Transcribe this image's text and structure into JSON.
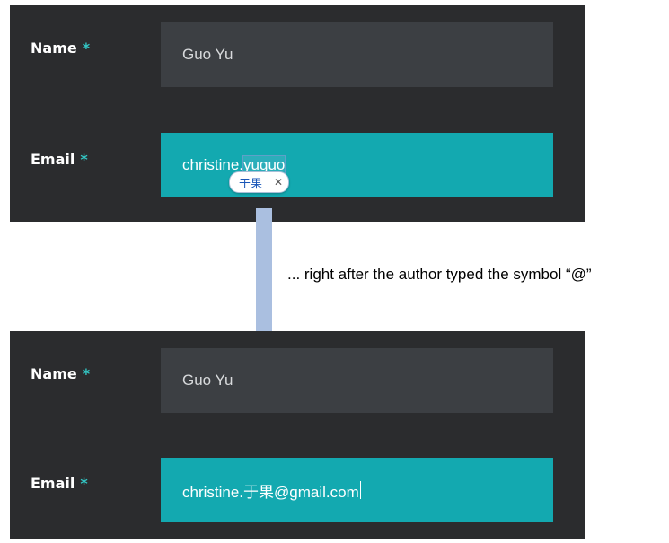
{
  "top_form": {
    "name_label": "Name",
    "name_required": "*",
    "name_value": "Guo Yu",
    "email_label": "Email",
    "email_required": "*",
    "email_prefix": "christine.",
    "email_composing": "yuguo",
    "ime_candidate": "于果",
    "ime_close": "✕"
  },
  "annotation": "... right after the author typed the symbol “@”",
  "bottom_form": {
    "name_label": "Name",
    "name_required": "*",
    "name_value": "Guo Yu",
    "email_label": "Email",
    "email_required": "*",
    "email_value": "christine.于果@gmail.com"
  },
  "colors": {
    "panel": "#2b2c2e",
    "name_field": "#3c3f43",
    "email_field": "#13a9b0",
    "required_star": "#33c7c5",
    "arrow": "#aabfe0"
  }
}
